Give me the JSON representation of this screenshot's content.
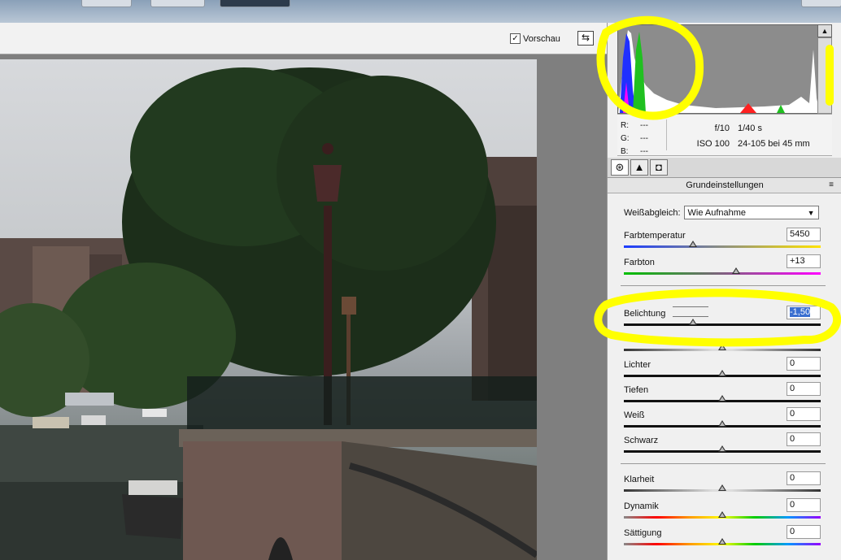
{
  "toolbar": {
    "preview_label": "Vorschau",
    "preview_checked": true
  },
  "histogram": {
    "r_label": "R:",
    "r_value": "---",
    "g_label": "G:",
    "g_value": "---",
    "b_label": "B:",
    "b_value": "---",
    "aperture": "f/10",
    "shutter": "1/40 s",
    "iso": "ISO 100",
    "lens": "24-105 bei 45 mm"
  },
  "panel": {
    "section_title": "Grundeinstellungen",
    "white_balance_label": "Weißabgleich:",
    "white_balance_value": "Wie Aufnahme",
    "sliders": {
      "temperature": {
        "label": "Farbtemperatur",
        "value": "5450",
        "level": 0.35
      },
      "tint": {
        "label": "Farbton",
        "value": "+13",
        "level": 0.57
      },
      "exposure": {
        "label": "Belichtung",
        "value": "-1,50",
        "level": 0.35
      },
      "contrast": {
        "label": "",
        "value": "",
        "level": 0.5
      },
      "highlights": {
        "label": "Lichter",
        "value": "0",
        "level": 0.5
      },
      "shadows": {
        "label": "Tiefen",
        "value": "0",
        "level": 0.5
      },
      "whites": {
        "label": "Weiß",
        "value": "0",
        "level": 0.5
      },
      "blacks": {
        "label": "Schwarz",
        "value": "0",
        "level": 0.5
      },
      "clarity": {
        "label": "Klarheit",
        "value": "0",
        "level": 0.5
      },
      "vibrance": {
        "label": "Dynamik",
        "value": "0",
        "level": 0.5
      },
      "saturation": {
        "label": "Sättigung",
        "value": "0",
        "level": 0.5
      }
    }
  },
  "colors": {
    "highlight": "#ffff00",
    "selection": "#3a6fd0"
  },
  "icons": [
    "checkbox-icon",
    "fullscreen-icon",
    "aperture-tab-icon",
    "tone-curve-tab-icon",
    "camera-tab-icon",
    "panel-menu-icon",
    "clip-warning-icon",
    "dropdown-arrow-icon"
  ]
}
